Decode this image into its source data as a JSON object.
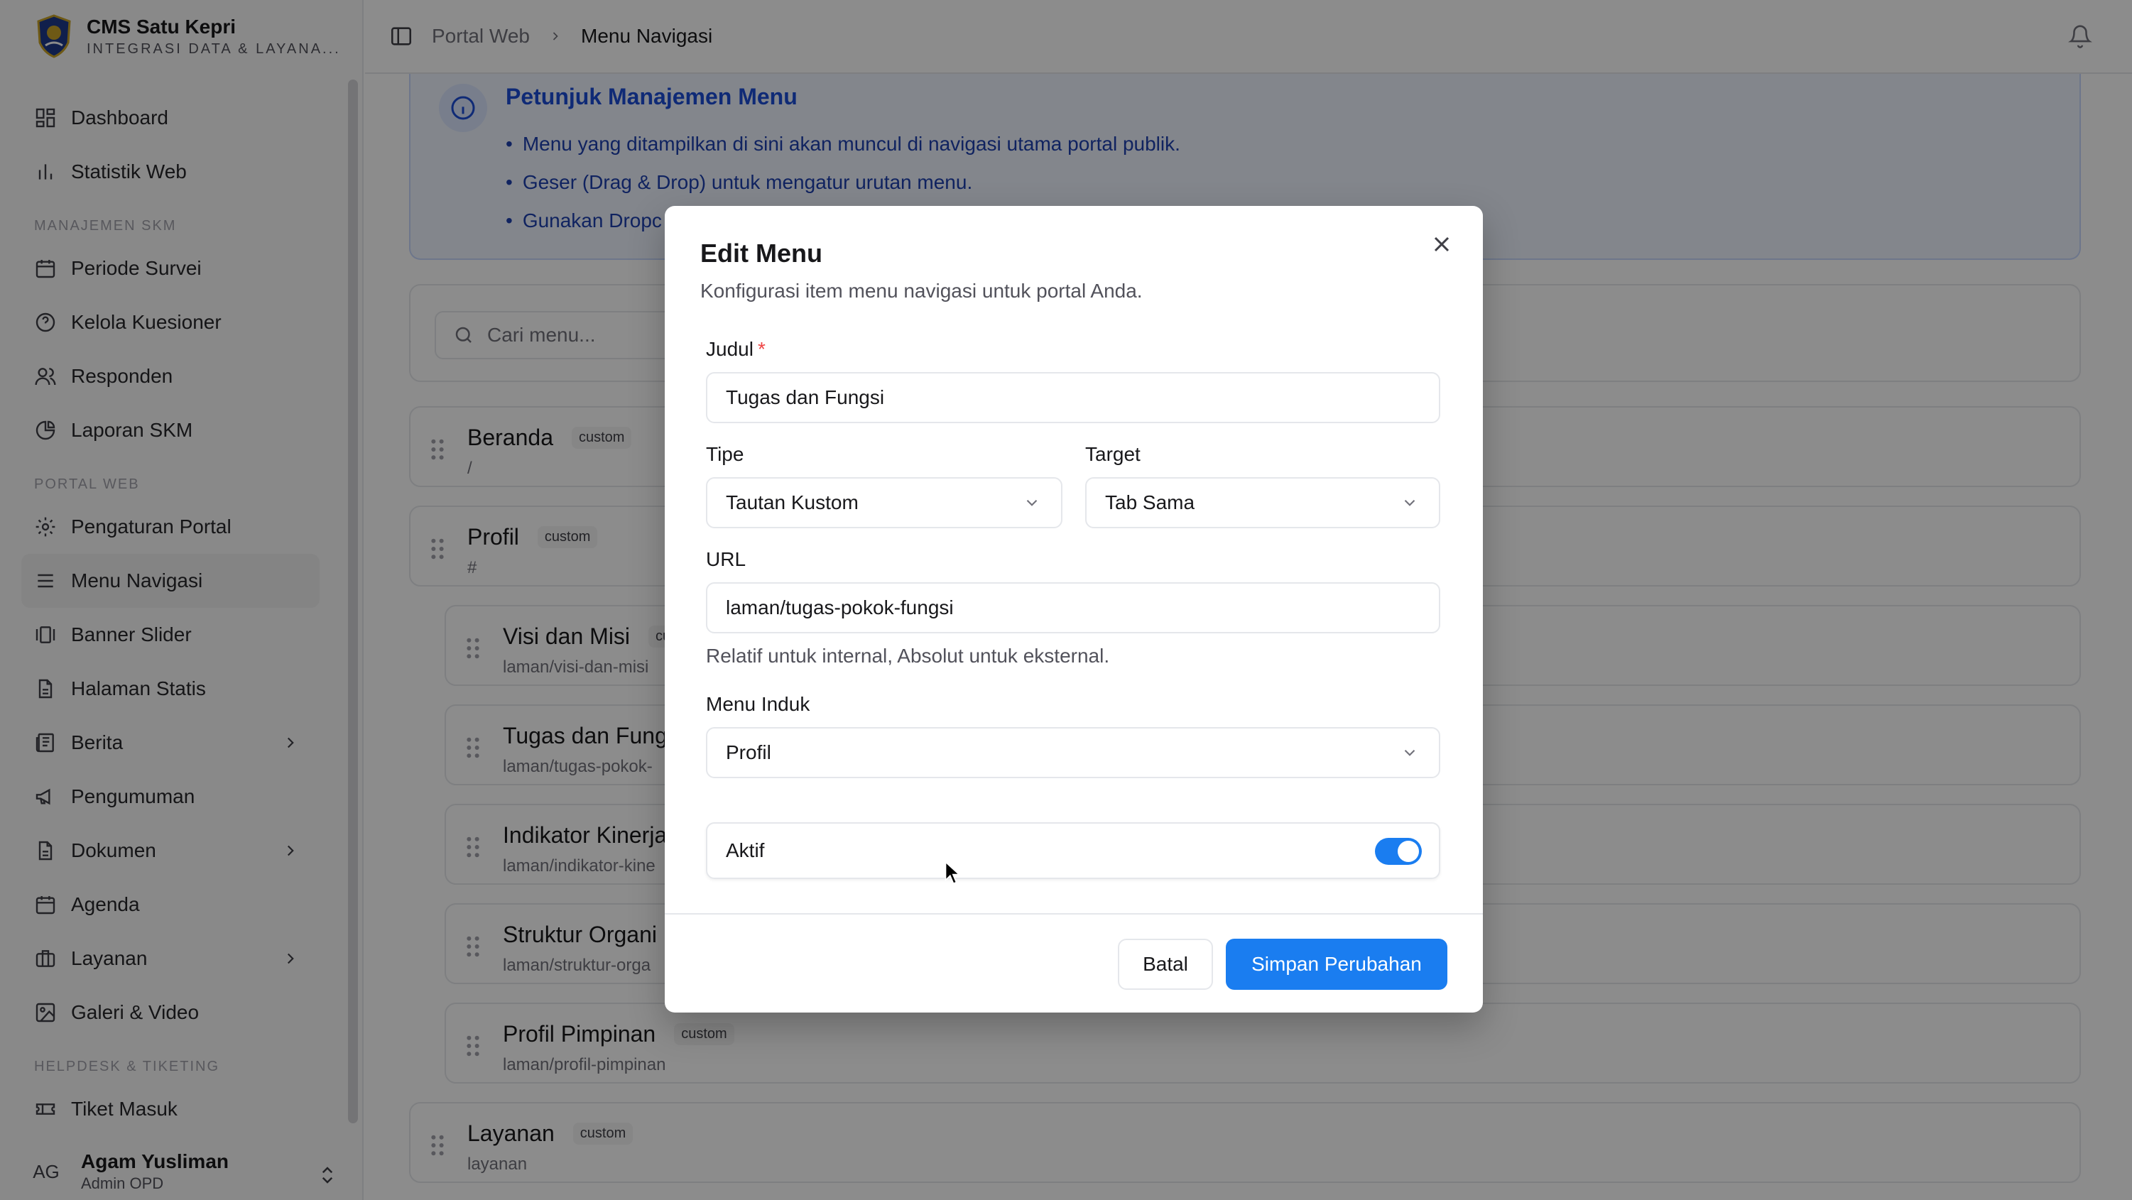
{
  "brand": {
    "title": "CMS Satu Kepri",
    "subtitle": "INTEGRASI DATA & LAYANA..."
  },
  "sidebar": {
    "items": [
      {
        "label": "Dashboard",
        "icon": "dashboard-icon"
      },
      {
        "label": "Statistik Web",
        "icon": "chart-icon"
      }
    ],
    "group_skm": "MANAJEMEN SKM",
    "skm_items": [
      {
        "label": "Periode Survei",
        "icon": "calendar-icon"
      },
      {
        "label": "Kelola Kuesioner",
        "icon": "help-circle-icon"
      },
      {
        "label": "Responden",
        "icon": "users-icon"
      },
      {
        "label": "Laporan SKM",
        "icon": "pie-chart-icon"
      }
    ],
    "group_portal": "PORTAL WEB",
    "portal_items": [
      {
        "label": "Pengaturan Portal",
        "icon": "gear-icon"
      },
      {
        "label": "Menu Navigasi",
        "icon": "menu-icon"
      },
      {
        "label": "Banner Slider",
        "icon": "gallery-icon"
      },
      {
        "label": "Halaman Statis",
        "icon": "file-icon"
      },
      {
        "label": "Berita",
        "icon": "newspaper-icon"
      },
      {
        "label": "Pengumuman",
        "icon": "megaphone-icon"
      },
      {
        "label": "Dokumen",
        "icon": "file-icon"
      },
      {
        "label": "Agenda",
        "icon": "calendar-icon"
      },
      {
        "label": "Layanan",
        "icon": "briefcase-icon"
      },
      {
        "label": "Galeri & Video",
        "icon": "image-icon"
      }
    ],
    "group_helpdesk": "HELPDESK & TIKETING",
    "helpdesk_items": [
      {
        "label": "Tiket Masuk",
        "icon": "ticket-icon"
      }
    ]
  },
  "user": {
    "initials": "AG",
    "name": "Agam Yusliman",
    "role": "Admin OPD"
  },
  "breadcrumb": {
    "parent": "Portal Web",
    "current": "Menu Navigasi"
  },
  "info": {
    "title": "Petunjuk Manajemen Menu",
    "lines": [
      "Menu yang ditampilkan di sini akan muncul di navigasi utama portal publik.",
      "Geser (Drag & Drop) untuk mengatur urutan menu.",
      "Gunakan Dropc"
    ]
  },
  "search": {
    "placeholder": "Cari menu..."
  },
  "menu_list": [
    {
      "title": "Beranda",
      "badge": "custom",
      "path": "/"
    },
    {
      "title": "Profil",
      "badge": "custom",
      "path": "#"
    },
    {
      "title": "Visi dan Misi",
      "badge": "cu",
      "path": "laman/visi-dan-misi"
    },
    {
      "title": "Tugas dan Fung",
      "badge": "",
      "path": "laman/tugas-pokok-"
    },
    {
      "title": "Indikator Kinerja",
      "badge": "",
      "path": "laman/indikator-kine"
    },
    {
      "title": "Struktur Organi",
      "badge": "",
      "path": "laman/struktur-orga"
    },
    {
      "title": "Profil Pimpinan",
      "badge": "custom",
      "path": "laman/profil-pimpinan"
    },
    {
      "title": "Layanan",
      "badge": "custom",
      "path": "layanan"
    }
  ],
  "modal": {
    "title": "Edit Menu",
    "description": "Konfigurasi item menu navigasi untuk portal Anda.",
    "judul_label": "Judul",
    "required_mark": "*",
    "judul_value": "Tugas dan Fungsi",
    "tipe_label": "Tipe",
    "tipe_value": "Tautan Kustom",
    "target_label": "Target",
    "target_value": "Tab Sama",
    "url_label": "URL",
    "url_value": "laman/tugas-pokok-fungsi",
    "url_hint": "Relatif untuk internal, Absolut untuk eksternal.",
    "parent_label": "Menu Induk",
    "parent_value": "Profil",
    "aktif_label": "Aktif",
    "aktif": true,
    "cancel_label": "Batal",
    "save_label": "Simpan Perubahan"
  },
  "colors": {
    "accent": "#1a7df0",
    "info_text": "#1d4ed8",
    "required": "#ef4444"
  }
}
